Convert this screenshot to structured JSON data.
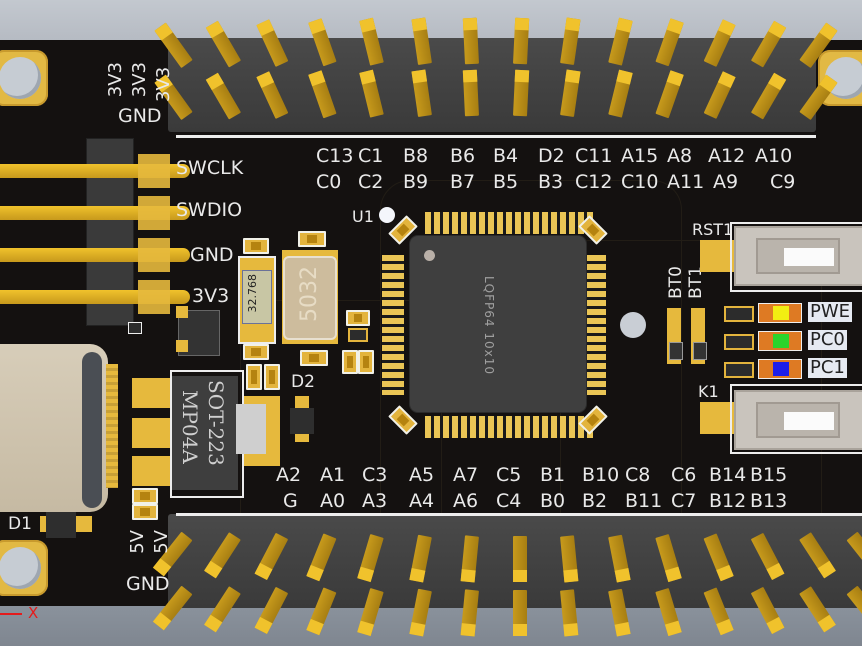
{
  "board": {
    "mcu": {
      "designator": "U1",
      "package_text": "LQFP64 10x10"
    },
    "crystal_32k": {
      "marking": "32.768"
    },
    "crystal_main": {
      "marking": "5032"
    },
    "regulator": {
      "line1": "SOT-223",
      "line2": "MP04A"
    },
    "diodes": [
      "D1",
      "D2"
    ]
  },
  "left_header_labels": {
    "power_top": [
      "3V3",
      "3V3",
      "3V3"
    ],
    "gnd_top": "GND",
    "power_bottom": [
      "5V",
      "5V"
    ],
    "gnd_bottom": "GND"
  },
  "swd_header": {
    "pins": [
      "SWCLK",
      "SWDIO",
      "GND",
      "3V3"
    ]
  },
  "top_header": {
    "row1": [
      "C13",
      "C1",
      "B8",
      "B6",
      "B4",
      "D2",
      "C11",
      "A15",
      "A8",
      "A12",
      "A10"
    ],
    "row2": [
      "C0",
      "C2",
      "B9",
      "B7",
      "B5",
      "B3",
      "C12",
      "C10",
      "A11",
      "A9",
      "C9"
    ]
  },
  "bottom_header": {
    "row1": [
      "A2",
      "A1",
      "C3",
      "A5",
      "A7",
      "C5",
      "B1",
      "B10",
      "C8",
      "C6",
      "B14",
      "B15"
    ],
    "row2": [
      "G",
      "A0",
      "A3",
      "A4",
      "A6",
      "C4",
      "B0",
      "B2",
      "B11",
      "C7",
      "B12",
      "B13"
    ]
  },
  "boot_jumpers": [
    "BT0",
    "BT1"
  ],
  "buttons": {
    "reset": {
      "label": "RST1"
    },
    "user": {
      "label": "K1"
    }
  },
  "leds": [
    {
      "label": "PWE",
      "color": "#f2ee12"
    },
    {
      "label": "PC0",
      "color": "#2bd42b"
    },
    {
      "label": "PC1",
      "color": "#1d1de8"
    }
  ],
  "axis_marker": {
    "label": "X",
    "color": "#e51b1b"
  },
  "colors": {
    "pcb": "#141110",
    "silkscreen": "#e9e9e9",
    "copper_gold": "#e6b93d",
    "pin_gold": "#f0c22c"
  }
}
